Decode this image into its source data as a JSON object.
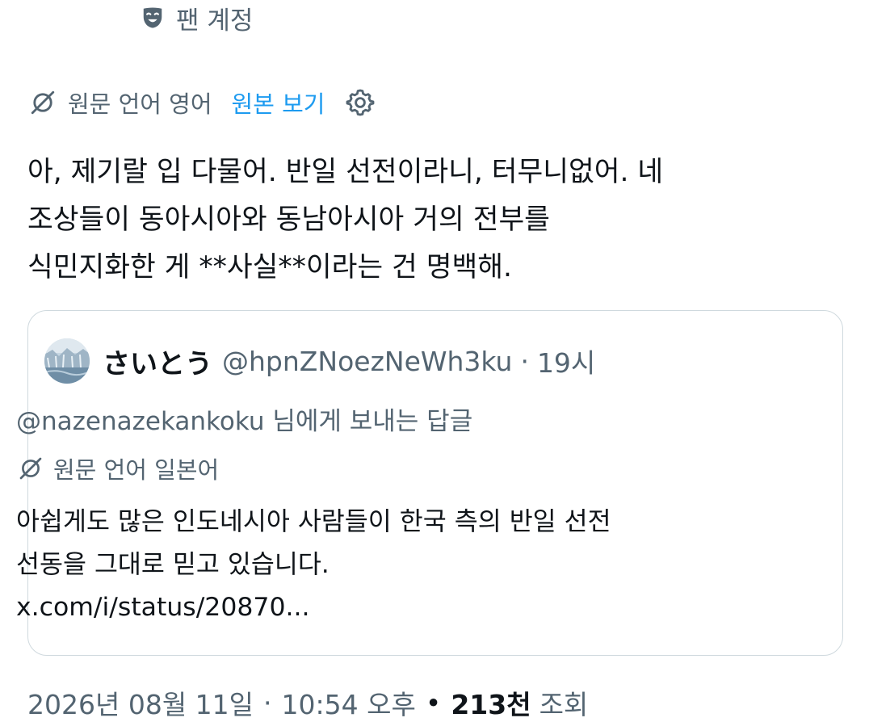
{
  "header": {
    "fan_account_icon": "theater-mask-icon",
    "fan_account_label": "팬 계정"
  },
  "translation": {
    "icon": "translate-icon",
    "source_language": "원문 언어 영어",
    "view_original": "원본 보기",
    "settings_icon": "gear-icon"
  },
  "post": {
    "lines": [
      "아, 제기랄 입 다물어. 반일 선전이라니, 터무니없어. 네",
      "조상들이 동아시아와 동남아시아 거의 전부를",
      "식민지화한 게 **사실**이라는 건 명백해."
    ]
  },
  "quote": {
    "avatar_icon": "avatar-image",
    "name": "さいとう",
    "handle": "@hpnZNoezNeWh3ku",
    "separator": "·",
    "time": "19시",
    "reply_mention": "@nazenazekankoku",
    "reply_suffix": " 님에게 보내는 답글",
    "source_language": "원문 언어 일본어",
    "lines": [
      "아쉽게도 많은 인도네시아 사람들이 한국 측의 반일 선전",
      "선동을 그대로 믿고 있습니다.",
      "x.com/i/status/20870..."
    ]
  },
  "meta": {
    "date": "2026년 08월 11일",
    "separator": "·",
    "time": "10:54 오후",
    "bullet": "•",
    "views_count": "213천",
    "views_label": "조회"
  },
  "colors": {
    "text_primary": "#0f1419",
    "text_secondary": "#536471",
    "link": "#1d9bf0",
    "border": "#cfd9de"
  }
}
